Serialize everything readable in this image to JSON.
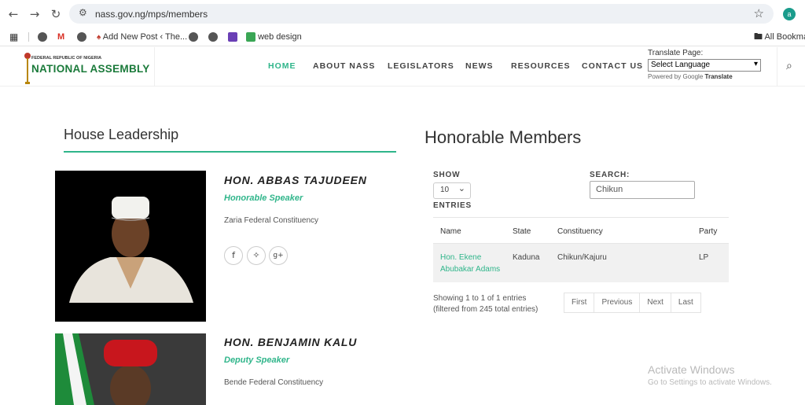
{
  "browser": {
    "url": "nass.gov.ng/mps/members",
    "profile_initial": "a",
    "bookmarks": [
      {
        "label": "",
        "icon": "globe-icon"
      },
      {
        "label": "",
        "icon": "gmail-icon"
      },
      {
        "label": "",
        "icon": "globe-icon"
      },
      {
        "label": "Add New Post ‹ The...",
        "icon": "wordpress-icon"
      },
      {
        "label": "",
        "icon": "globe-icon"
      },
      {
        "label": "",
        "icon": "globe-icon"
      },
      {
        "label": "",
        "icon": "purple-app-icon"
      },
      {
        "label": "web design",
        "icon": "green-app-icon"
      }
    ],
    "all_bookmarks": "All Bookma"
  },
  "site": {
    "logo_small": "FEDERAL REPUBLIC OF NIGERIA",
    "logo_big": "NATIONAL ASSEMBLY",
    "nav": [
      "HOME",
      "ABOUT NASS",
      "LEGISLATORS",
      "NEWS",
      "RESOURCES",
      "CONTACT US"
    ],
    "active_nav": "HOME",
    "translate_label": "Translate Page:",
    "translate_select": "Select Language",
    "powered_by": "Powered by",
    "google": "Google",
    "translate_word": "Translate"
  },
  "leadership": {
    "title": "House Leadership",
    "leaders": [
      {
        "name": "HON. ABBAS TAJUDEEN",
        "role": "Honorable Speaker",
        "constituency": "Zaria Federal Constituency"
      },
      {
        "name": "HON. BENJAMIN KALU",
        "role": "Deputy Speaker",
        "constituency": "Bende Federal Constituency"
      }
    ]
  },
  "members": {
    "title": "Honorable Members",
    "show_label": "SHOW",
    "show_value": "10",
    "entries_label": "ENTRIES",
    "search_label": "SEARCH:",
    "search_value": "Chikun",
    "columns": [
      "Name",
      "State",
      "Constituency",
      "Party"
    ],
    "rows": [
      {
        "name": "Hon. Ekene Abubakar Adams",
        "state": "Kaduna",
        "constituency": "Chikun/Kajuru",
        "party": "LP"
      }
    ],
    "info_line1": "Showing 1 to 1 of 1 entries",
    "info_line2": "(filtered from 245 total entries)",
    "pager": [
      "First",
      "Previous",
      "Next",
      "Last"
    ]
  },
  "watermark": {
    "line1": "Activate Windows",
    "line2": "Go to Settings to activate Windows."
  },
  "colors": {
    "accent": "#2fb58a",
    "logo_green": "#1a7a3a"
  }
}
